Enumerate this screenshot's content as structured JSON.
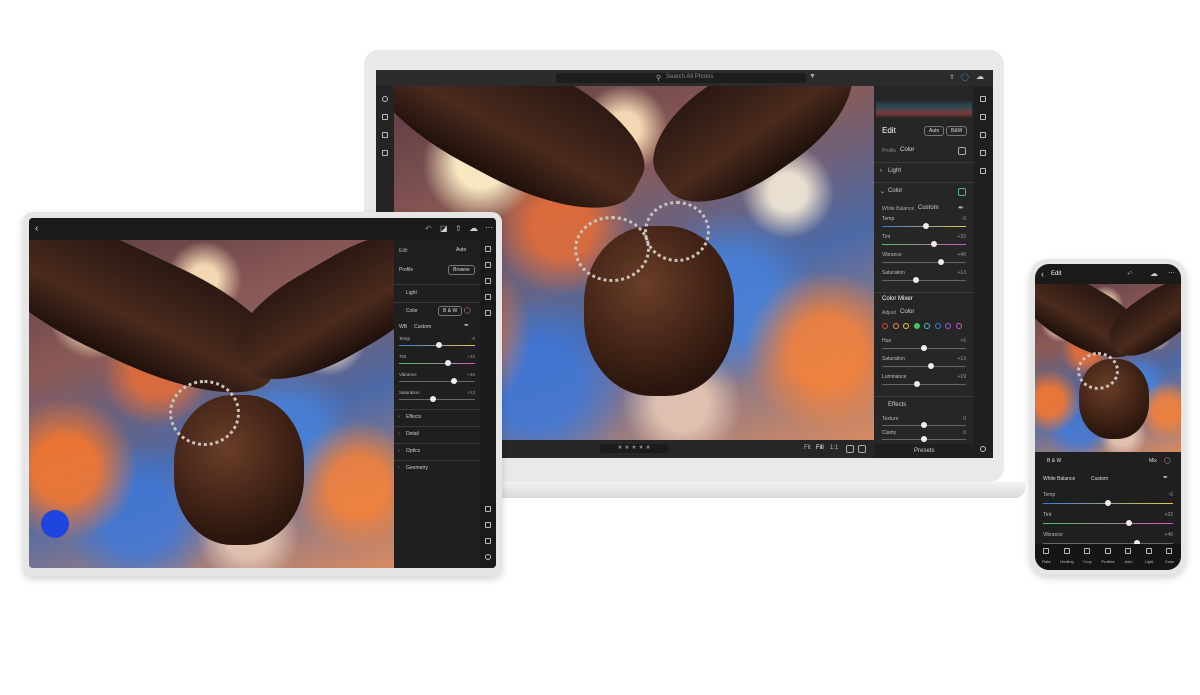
{
  "laptop": {
    "search_placeholder": "Search All Photos",
    "panel": {
      "title": "Edit",
      "auto": "Auto",
      "bw": "B&W",
      "profile_label": "Profile",
      "profile_value": "Color",
      "light": "Light",
      "color": "Color",
      "white_balance_label": "White Balance",
      "white_balance_value": "Custom",
      "sliders": [
        {
          "label": "Temp",
          "value": "-6",
          "level": 0.52
        },
        {
          "label": "Tint",
          "value": "+32",
          "level": 0.62
        },
        {
          "label": "Vibrance",
          "value": "+46",
          "level": 0.7
        },
        {
          "label": "Saturation",
          "value": "+13",
          "level": 0.4
        }
      ],
      "color_mixer": "Color Mixer",
      "adjust_label": "Adjust",
      "adjust_value": "Color",
      "mixer_sliders": [
        {
          "label": "Hue",
          "value": "+5",
          "level": 0.5
        },
        {
          "label": "Saturation",
          "value": "+13",
          "level": 0.58
        },
        {
          "label": "Luminance",
          "value": "+19",
          "level": 0.42
        }
      ],
      "effects": "Effects",
      "effect_sliders": [
        {
          "label": "Texture",
          "value": "0",
          "level": 0.5
        },
        {
          "label": "Clarity",
          "value": "0",
          "level": 0.5
        }
      ],
      "presets": "Presets"
    },
    "filmstrip": {
      "fit": "Fit",
      "fill": "Fill",
      "ratio": "1:1"
    },
    "mixer_colors": [
      "#e0473f",
      "#e8833a",
      "#e8c93a",
      "#4cc25a",
      "#3ec0c9",
      "#3b79e0",
      "#9b57e0",
      "#d957c1"
    ]
  },
  "tablet": {
    "panel": {
      "edit": "Edit",
      "auto": "Auto",
      "profile": "Profile",
      "browse": "Browse",
      "light": "Light",
      "color": "Color",
      "bw": "B & W",
      "wb": "WB",
      "wb_value": "Custom",
      "sliders": [
        {
          "label": "Temp",
          "value": "-6",
          "level": 0.52
        },
        {
          "label": "Tint",
          "value": "+32",
          "level": 0.64
        },
        {
          "label": "Vibrance",
          "value": "+46",
          "level": 0.72
        },
        {
          "label": "Saturation",
          "value": "+13",
          "level": 0.45
        }
      ],
      "sections": [
        "Effects",
        "Detail",
        "Optics",
        "Geometry"
      ]
    }
  },
  "phone": {
    "header": "Edit",
    "bw": "B & W",
    "mix": "Mix",
    "white_balance_label": "White Balance",
    "white_balance_value": "Custom",
    "sliders": [
      {
        "label": "Temp",
        "value": "-6",
        "level": 0.5
      },
      {
        "label": "Tint",
        "value": "+32",
        "level": 0.66
      },
      {
        "label": "Vibrance",
        "value": "+46",
        "level": 0.72
      }
    ],
    "toolbar": [
      "Rate",
      "Healing",
      "Crop",
      "Profiles",
      "Auto",
      "Light",
      "Color"
    ]
  }
}
